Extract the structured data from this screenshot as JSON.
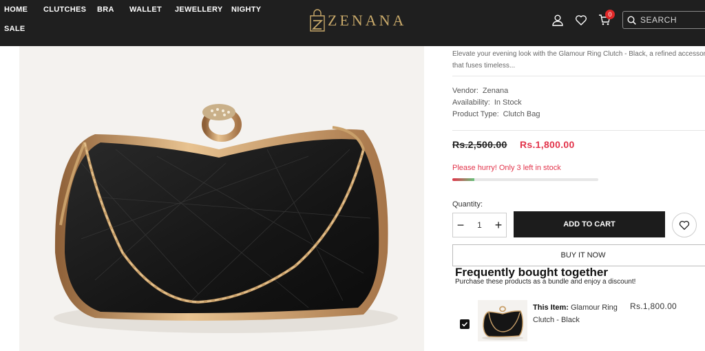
{
  "brand": {
    "logo_text": "ZENANA"
  },
  "nav": {
    "items": [
      "HOME",
      "CLUTCHES",
      "BRA",
      "WALLET",
      "JEWELLERY",
      "NIGHTY",
      "SALE"
    ]
  },
  "header": {
    "cart_count": "0",
    "search_placeholder": "SEARCH",
    "icons": [
      "user-icon",
      "heart-icon",
      "cart-icon",
      "search-icon"
    ]
  },
  "product": {
    "description_line1": "Elevate your evening look with the Glamour Ring Clutch - Black, a refined accessory",
    "description_line2": "that fuses timeless...",
    "vendor_label": "Vendor:",
    "vendor_value": "Zenana",
    "availability_label": "Availability:",
    "availability_value": "In Stock",
    "type_label": "Product Type:",
    "type_value": "Clutch Bag",
    "price_old": "Rs.2,500.00",
    "price_new": "Rs.1,800.00",
    "stock_message": "Please hurry! Only 3 left in stock",
    "stock_level": 0.15,
    "quantity_label": "Quantity:",
    "quantity_value": "1",
    "add_to_cart": "ADD TO CART",
    "buy_now": "BUY IT NOW"
  },
  "bundle": {
    "title": "Frequently bought together",
    "subtitle": "Purchase these products as a bundle and enjoy a discount!",
    "item_prefix": "This Item:",
    "item_name": "Glamour Ring Clutch - Black",
    "item_price": "Rs.1,800.00",
    "checked": true
  },
  "colors": {
    "header_bg": "#1f1f1f",
    "accent_gold": "#c8a96a",
    "sale_red": "#e2334a",
    "button_dark": "#1c1c1c"
  }
}
